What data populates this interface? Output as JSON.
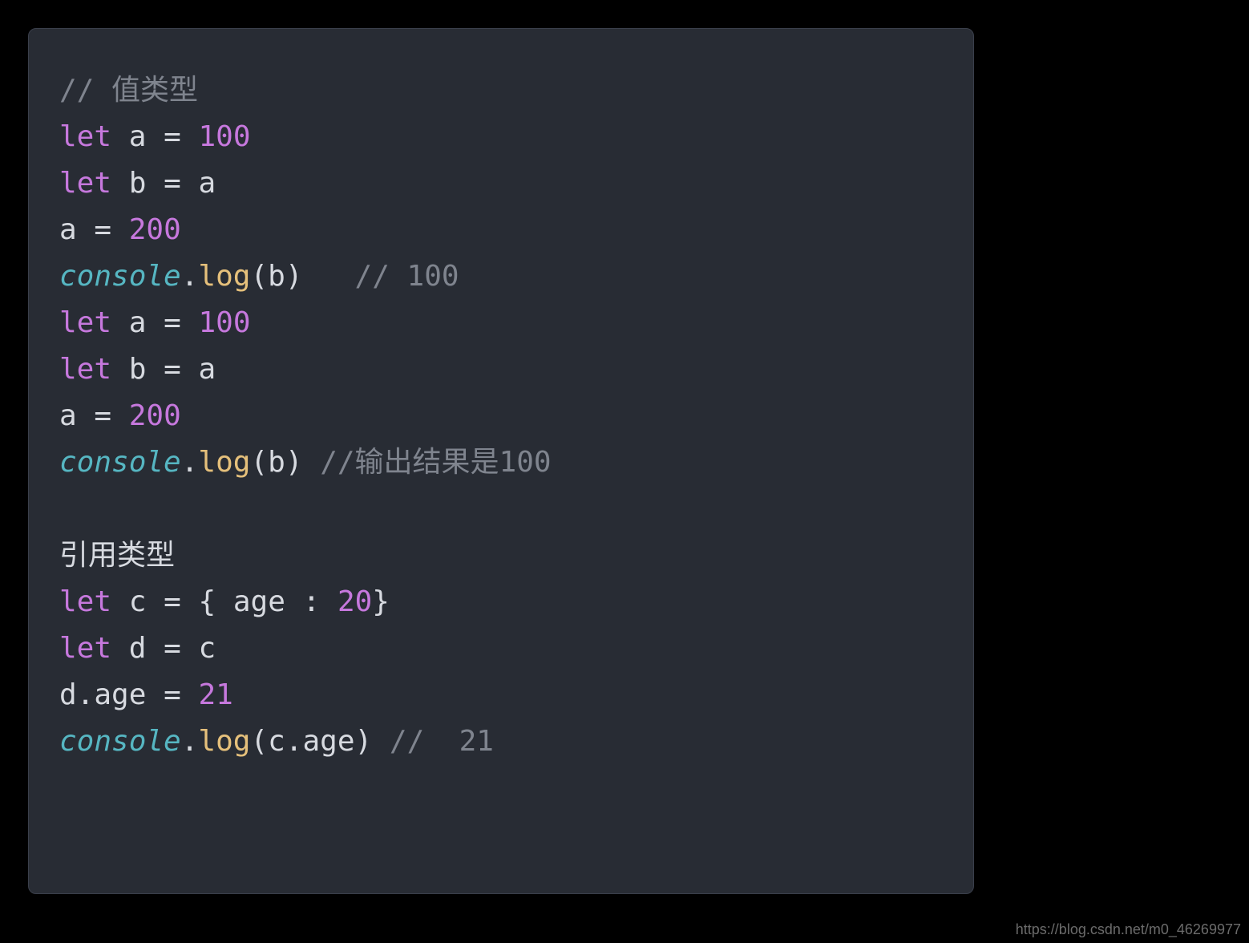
{
  "code": {
    "line1": {
      "comment": "// 值类型"
    },
    "line2": {
      "kw": "let",
      "sp1": " ",
      "id": "a",
      "sp2": " ",
      "op": "=",
      "sp3": " ",
      "num": "100"
    },
    "line3": {
      "kw": "let",
      "sp1": " ",
      "id": "b",
      "sp2": " ",
      "op": "=",
      "sp3": " ",
      "rhs": "a"
    },
    "line4": {
      "id": "a",
      "sp1": " ",
      "op": "=",
      "sp2": " ",
      "num": "200"
    },
    "line5": {
      "console": "console",
      "dot": ".",
      "func": "log",
      "open": "(",
      "arg": "b",
      "close": ")",
      "gap": "   ",
      "comment": "// 100"
    },
    "line6": {
      "kw": "let",
      "sp1": " ",
      "id": "a",
      "sp2": " ",
      "op": "=",
      "sp3": " ",
      "num": "100"
    },
    "line7": {
      "kw": "let",
      "sp1": " ",
      "id": "b",
      "sp2": " ",
      "op": "=",
      "sp3": " ",
      "rhs": "a"
    },
    "line8": {
      "id": "a",
      "sp1": " ",
      "op": "=",
      "sp2": " ",
      "num": "200"
    },
    "line9": {
      "console": "console",
      "dot": ".",
      "func": "log",
      "open": "(",
      "arg": "b",
      "close": ")",
      "gap": " ",
      "comment": "//输出结果是100"
    },
    "line10": {
      "blank": ""
    },
    "line11": {
      "plain": "引用类型"
    },
    "line12": {
      "kw": "let",
      "sp1": " ",
      "id": "c",
      "sp2": " ",
      "op": "=",
      "sp3": " ",
      "brace_open": "{",
      "sp4": " ",
      "prop": "age",
      "sp5": " ",
      "colon": ":",
      "sp6": " ",
      "num": "20",
      "brace_close": "}"
    },
    "line13": {
      "kw": "let",
      "sp1": " ",
      "id": "d",
      "sp2": " ",
      "op": "=",
      "sp3": " ",
      "rhs": "c"
    },
    "line14": {
      "obj": "d",
      "dot": ".",
      "prop": "age",
      "sp1": " ",
      "op": "=",
      "sp2": " ",
      "num": "21"
    },
    "line15": {
      "console": "console",
      "dot": ".",
      "func": "log",
      "open": "(",
      "arg_obj": "c",
      "arg_dot": ".",
      "arg_prop": "age",
      "close": ")",
      "gap": " ",
      "comment": "//  21"
    }
  },
  "watermark": "https://blog.csdn.net/m0_46269977"
}
